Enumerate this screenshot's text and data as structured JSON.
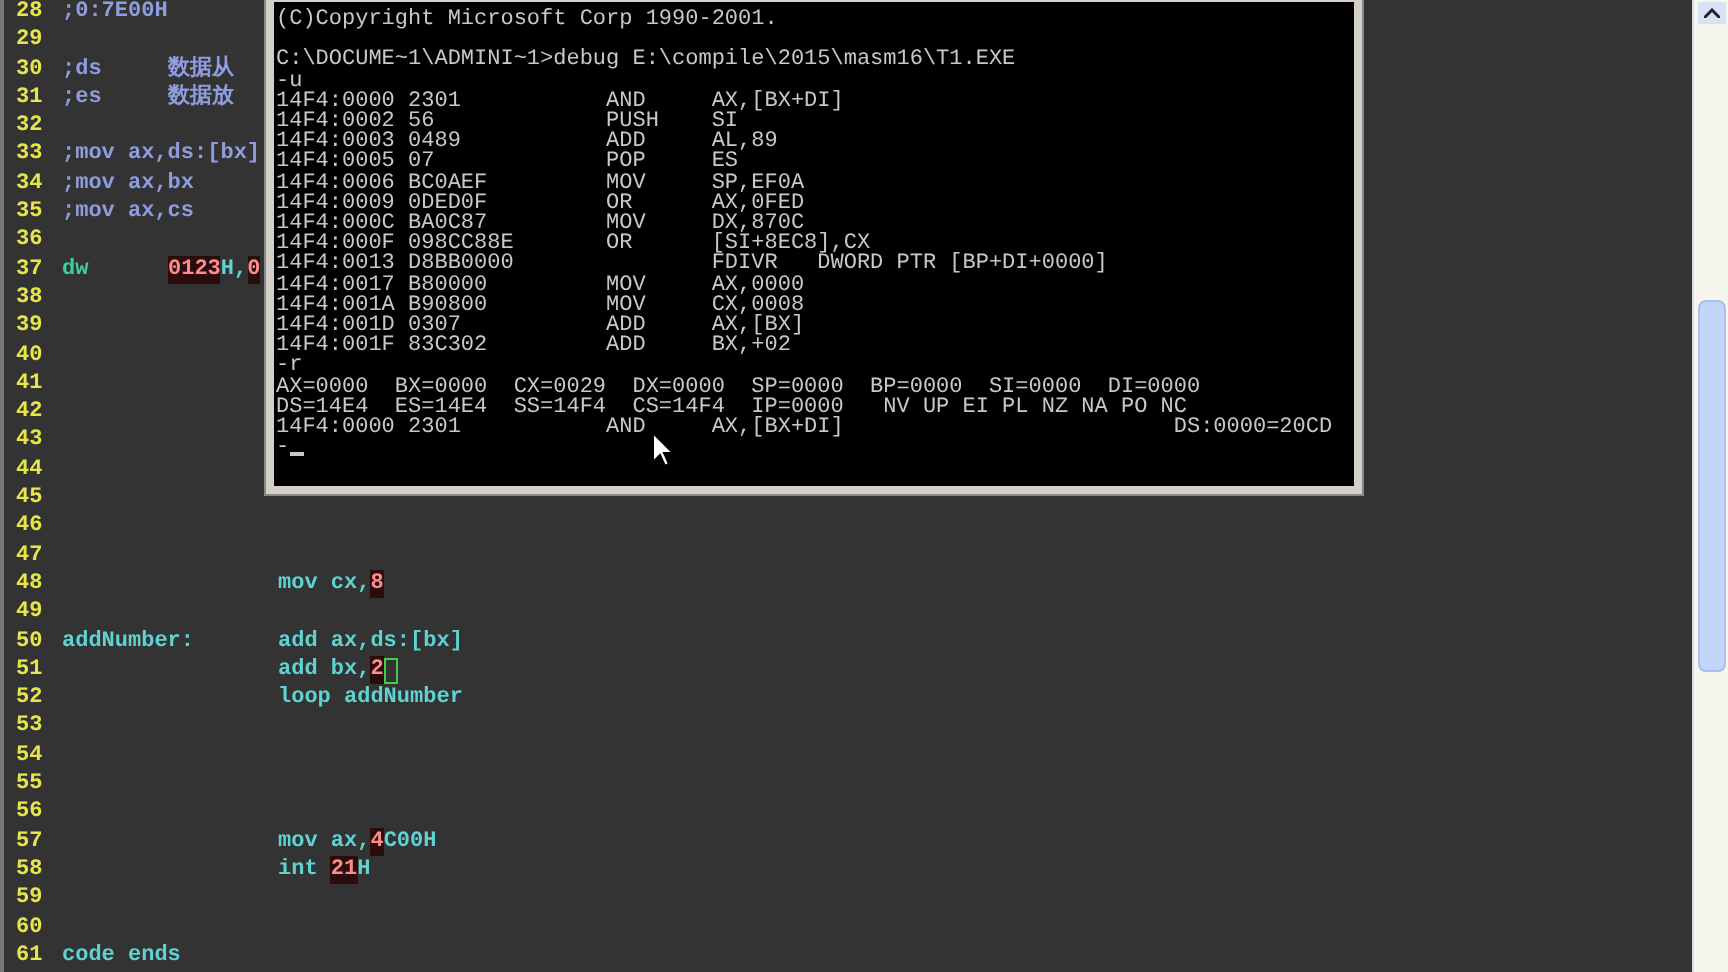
{
  "editor": {
    "lines": [
      {
        "number": "28",
        "caret": false,
        "first": [
          {
            "text": ";0:7E00H",
            "kind": "comment"
          }
        ]
      },
      {
        "number": "29",
        "caret": false
      },
      {
        "number": "30",
        "caret": false,
        "first": [
          {
            "text": ";ds",
            "kind": "comment"
          }
        ],
        "second": [
          {
            "text": "数据从",
            "kind": "comment"
          }
        ]
      },
      {
        "number": "31",
        "caret": false,
        "first": [
          {
            "text": ";es",
            "kind": "comment"
          }
        ],
        "second": [
          {
            "text": "数据放",
            "kind": "comment"
          }
        ]
      },
      {
        "number": "32",
        "caret": false
      },
      {
        "number": "33",
        "caret": false,
        "first": [
          {
            "text": ";mov ax,ds:[bx]",
            "kind": "comment"
          }
        ]
      },
      {
        "number": "34",
        "caret": false,
        "first": [
          {
            "text": ";mov ax,bx",
            "kind": "comment"
          }
        ]
      },
      {
        "number": "35",
        "caret": false,
        "first": [
          {
            "text": ";mov ax,cs",
            "kind": "comment"
          }
        ]
      },
      {
        "number": "36",
        "caret": false
      },
      {
        "number": "37",
        "caret": false,
        "first": [
          {
            "text": "dw",
            "kind": "keyword"
          }
        ],
        "second": [
          {
            "text": "0123",
            "kind": "number"
          },
          {
            "text": "H,",
            "kind": "code"
          },
          {
            "text": "0",
            "kind": "number"
          }
        ]
      },
      {
        "number": "38",
        "caret": false
      },
      {
        "number": "39",
        "caret": false
      },
      {
        "number": "40",
        "caret": false
      },
      {
        "number": "41",
        "caret": false
      },
      {
        "number": "42",
        "caret": false
      },
      {
        "number": "43",
        "caret": false
      },
      {
        "number": "44",
        "caret": false
      },
      {
        "number": "45",
        "caret": false
      },
      {
        "number": "46",
        "caret": false
      },
      {
        "number": "47",
        "caret": false
      },
      {
        "number": "48",
        "caret": false,
        "third": [
          {
            "text": "mov cx,",
            "kind": "code"
          },
          {
            "text": "8",
            "kind": "number"
          }
        ]
      },
      {
        "number": "49",
        "caret": false
      },
      {
        "number": "50",
        "caret": false,
        "first": [
          {
            "text": "addNumber:",
            "kind": "code"
          }
        ],
        "third": [
          {
            "text": "add ax,ds:[bx]",
            "kind": "code"
          }
        ]
      },
      {
        "number": "51",
        "caret": true,
        "third": [
          {
            "text": "add bx,",
            "kind": "code"
          },
          {
            "text": "2",
            "kind": "number"
          }
        ]
      },
      {
        "number": "52",
        "caret": false,
        "third": [
          {
            "text": "loop addNumber",
            "kind": "code"
          }
        ]
      },
      {
        "number": "53",
        "caret": false
      },
      {
        "number": "54",
        "caret": false
      },
      {
        "number": "55",
        "caret": false
      },
      {
        "number": "56",
        "caret": false
      },
      {
        "number": "57",
        "caret": false,
        "third": [
          {
            "text": "mov ax,",
            "kind": "code"
          },
          {
            "text": "4",
            "kind": "number"
          },
          {
            "text": "C00H",
            "kind": "code"
          }
        ]
      },
      {
        "number": "58",
        "caret": false,
        "third": [
          {
            "text": "int ",
            "kind": "code"
          },
          {
            "text": "21",
            "kind": "number"
          },
          {
            "text": "H",
            "kind": "code"
          }
        ]
      },
      {
        "number": "59",
        "caret": false
      },
      {
        "number": "60",
        "caret": false
      },
      {
        "number": "61",
        "caret": false,
        "first": [
          {
            "text": "code ends",
            "kind": "code"
          }
        ]
      }
    ]
  },
  "console": {
    "lines": [
      "(C)Copyright Microsoft Corp 1990-2001.",
      "C:\\DOCUME~1\\ADMINI~1>debug E:\\compile\\2015\\masm16\\T1.EXE",
      "-u",
      "14F4:0000 2301           AND     AX,[BX+DI]",
      "14F4:0002 56             PUSH    SI",
      "14F4:0003 0489           ADD     AL,89",
      "14F4:0005 07             POP     ES",
      "14F4:0006 BC0AEF         MOV     SP,EF0A",
      "14F4:0009 0DED0F         OR      AX,0FED",
      "14F4:000C BA0C87         MOV     DX,870C",
      "14F4:000F 098CC88E       OR      [SI+8EC8],CX",
      "14F4:0013 D8BB0000               FDIVR   DWORD PTR [BP+DI+0000]",
      "14F4:0017 B80000         MOV     AX,0000",
      "14F4:001A B90800         MOV     CX,0008",
      "14F4:001D 0307           ADD     AX,[BX]",
      "14F4:001F 83C302         ADD     BX,+02",
      "-r",
      "AX=0000  BX=0000  CX=0029  DX=0000  SP=0000  BP=0000  SI=0000  DI=0000",
      "DS=14E4  ES=14E4  SS=14F4  CS=14F4  IP=0000   NV UP EI PL NZ NA PO NC",
      "14F4:0000 2301           AND     AX,[BX+DI]                         DS:0000=20CD",
      "-"
    ]
  }
}
